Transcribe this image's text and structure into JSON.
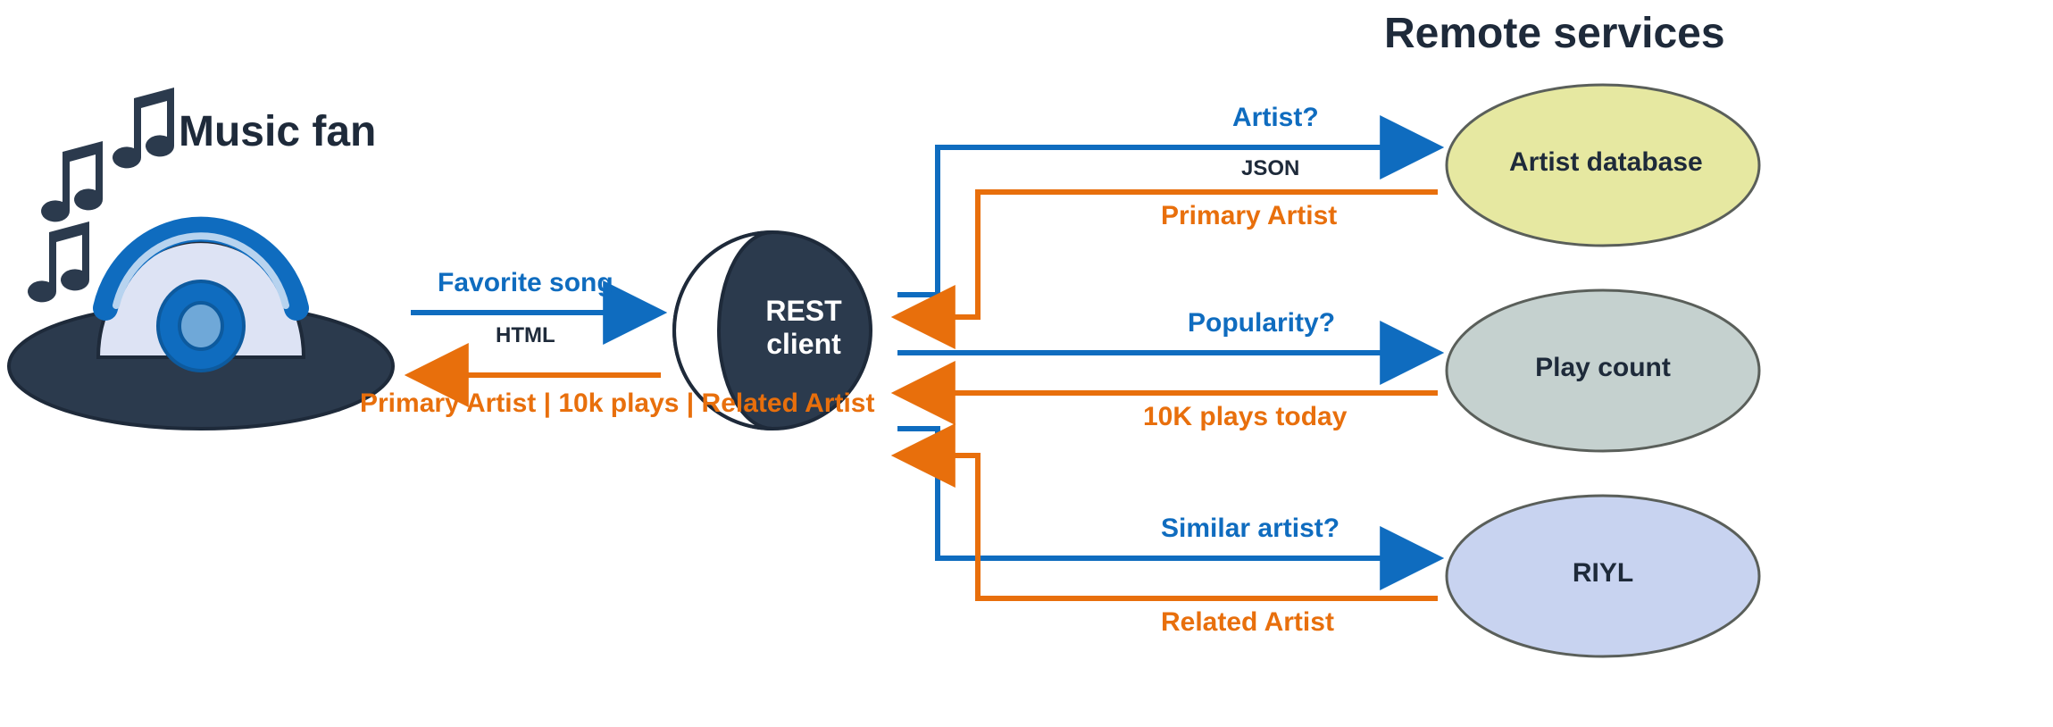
{
  "headings": {
    "left": "Music fan",
    "right": "Remote services"
  },
  "center_node": {
    "line1": "REST",
    "line2": "client"
  },
  "left_arrows": {
    "request_label": "Favorite song",
    "protocol": "HTML",
    "response_label": "Primary Artist |  10k plays  |  Related Artist"
  },
  "services": [
    {
      "name": "Artist database",
      "request": "Artist?",
      "format": "JSON",
      "response": "Primary Artist"
    },
    {
      "name": "Play count",
      "request": "Popularity?",
      "format": "",
      "response": "10K plays today"
    },
    {
      "name": "RIYL",
      "request": "Similar artist?",
      "format": "",
      "response": "Related Artist"
    }
  ],
  "colors": {
    "blue": "#0f6cbf",
    "orange": "#e86f0c",
    "dark": "#2b3a4d",
    "service_fill_1": "#e6e8a1",
    "service_fill_2": "#c5d1cf",
    "service_fill_3": "#c8d3f0"
  }
}
